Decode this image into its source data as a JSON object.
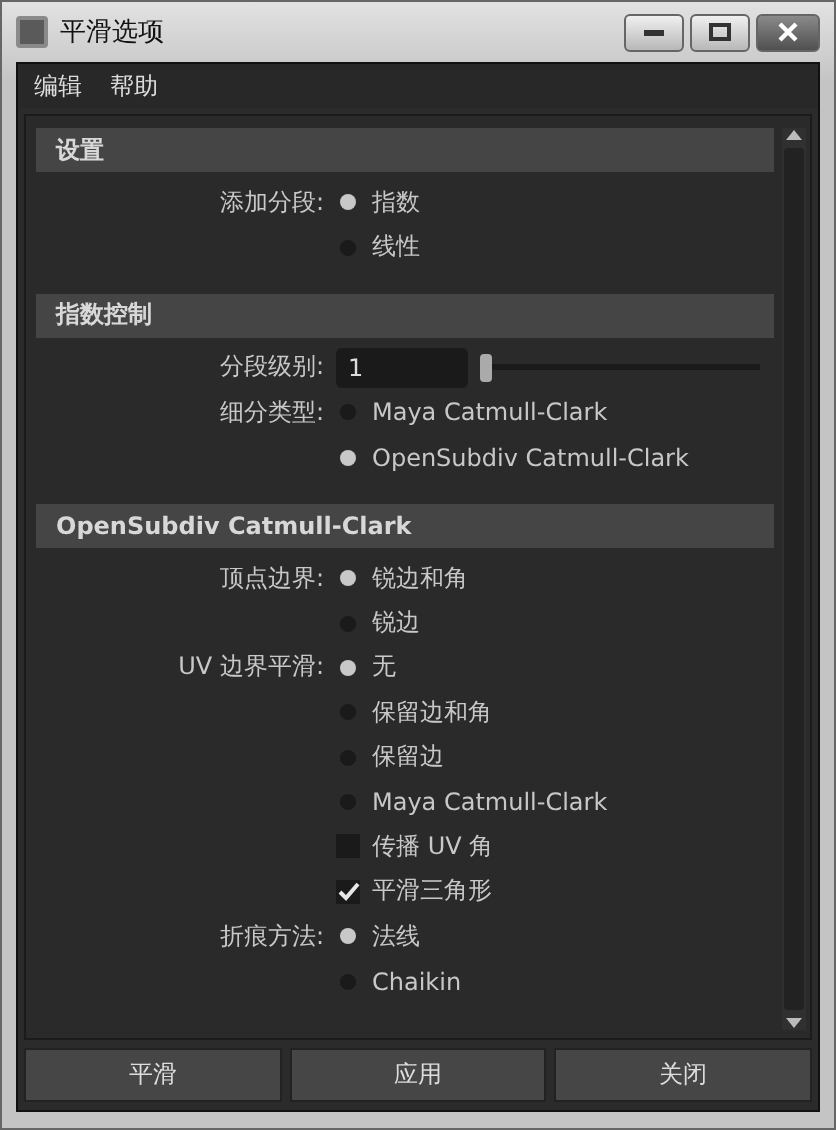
{
  "window": {
    "title": "平滑选项"
  },
  "menu": [
    "编辑",
    "帮助"
  ],
  "sections": [
    {
      "title": "设置",
      "groups": [
        {
          "kind": "radio",
          "label": "添加分段:",
          "options": [
            {
              "label": "指数",
              "selected": true
            },
            {
              "label": "线性",
              "selected": false
            }
          ]
        }
      ]
    },
    {
      "title": "指数控制",
      "groups": [
        {
          "kind": "slider",
          "label": "分段级别:",
          "value": "1",
          "level": 0
        },
        {
          "kind": "radio",
          "label": "细分类型:",
          "options": [
            {
              "label": "Maya Catmull-Clark",
              "selected": false
            },
            {
              "label": "OpenSubdiv Catmull-Clark",
              "selected": true
            }
          ]
        }
      ]
    },
    {
      "title": "OpenSubdiv Catmull-Clark",
      "groups": [
        {
          "kind": "radio",
          "label": "顶点边界:",
          "options": [
            {
              "label": "锐边和角",
              "selected": true
            },
            {
              "label": "锐边",
              "selected": false
            }
          ]
        },
        {
          "kind": "radio",
          "label": "UV 边界平滑:",
          "options": [
            {
              "label": "无",
              "selected": true
            },
            {
              "label": "保留边和角",
              "selected": false
            },
            {
              "label": "保留边",
              "selected": false
            },
            {
              "label": "Maya Catmull-Clark",
              "selected": false
            }
          ]
        },
        {
          "kind": "checkbox",
          "label": "传播 UV 角",
          "checked": false
        },
        {
          "kind": "checkbox",
          "label": "平滑三角形",
          "checked": true
        },
        {
          "kind": "radio",
          "label": "折痕方法:",
          "options": [
            {
              "label": "法线",
              "selected": true
            },
            {
              "label": "Chaikin",
              "selected": false
            }
          ]
        }
      ]
    }
  ],
  "buttons": [
    "平滑",
    "应用",
    "关闭"
  ]
}
